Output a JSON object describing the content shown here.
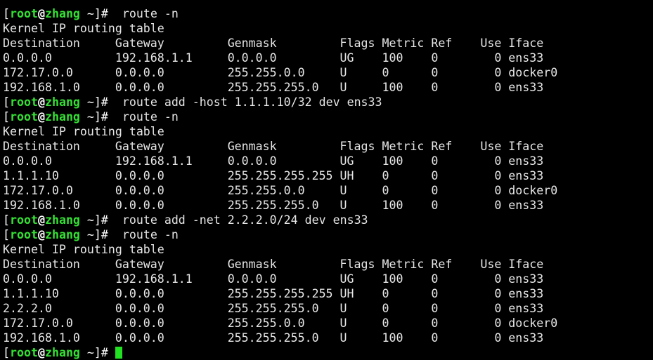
{
  "prompt": {
    "open": "[",
    "user": "root",
    "at": "@",
    "host": "zhang",
    "cwd": " ~",
    "close": "]",
    "symbol": "#"
  },
  "theme": {
    "background": "#000000",
    "text": "#e6e6e6",
    "prompt_user_color": "#35e035",
    "cursor_color": "#22e022"
  },
  "session": [
    {
      "type": "command",
      "text": "  route -n"
    },
    {
      "type": "output",
      "text": "Kernel IP routing table"
    },
    {
      "type": "output",
      "text": "Destination     Gateway         Genmask         Flags Metric Ref    Use Iface"
    },
    {
      "type": "output",
      "text": "0.0.0.0         192.168.1.1     0.0.0.0         UG    100    0        0 ens33"
    },
    {
      "type": "output",
      "text": "172.17.0.0      0.0.0.0         255.255.0.0     U     0      0        0 docker0"
    },
    {
      "type": "output",
      "text": "192.168.1.0     0.0.0.0         255.255.255.0   U     100    0        0 ens33"
    },
    {
      "type": "command",
      "text": "  route add -host 1.1.1.10/32 dev ens33"
    },
    {
      "type": "command",
      "text": "  route -n"
    },
    {
      "type": "output",
      "text": "Kernel IP routing table"
    },
    {
      "type": "output",
      "text": "Destination     Gateway         Genmask         Flags Metric Ref    Use Iface"
    },
    {
      "type": "output",
      "text": "0.0.0.0         192.168.1.1     0.0.0.0         UG    100    0        0 ens33"
    },
    {
      "type": "output",
      "text": "1.1.1.10        0.0.0.0         255.255.255.255 UH    0      0        0 ens33"
    },
    {
      "type": "output",
      "text": "172.17.0.0      0.0.0.0         255.255.0.0     U     0      0        0 docker0"
    },
    {
      "type": "output",
      "text": "192.168.1.0     0.0.0.0         255.255.255.0   U     100    0        0 ens33"
    },
    {
      "type": "command",
      "text": "  route add -net 2.2.2.0/24 dev ens33"
    },
    {
      "type": "command",
      "text": "  route -n"
    },
    {
      "type": "output",
      "text": "Kernel IP routing table"
    },
    {
      "type": "output",
      "text": "Destination     Gateway         Genmask         Flags Metric Ref    Use Iface"
    },
    {
      "type": "output",
      "text": "0.0.0.0         192.168.1.1     0.0.0.0         UG    100    0        0 ens33"
    },
    {
      "type": "output",
      "text": "1.1.1.10        0.0.0.0         255.255.255.255 UH    0      0        0 ens33"
    },
    {
      "type": "output",
      "text": "2.2.2.0         0.0.0.0         255.255.255.0   U     0      0        0 ens33"
    },
    {
      "type": "output",
      "text": "172.17.0.0      0.0.0.0         255.255.0.0     U     0      0        0 docker0"
    },
    {
      "type": "output",
      "text": "192.168.1.0     0.0.0.0         255.255.255.0   U     100    0        0 ens33"
    },
    {
      "type": "active",
      "text": " "
    }
  ]
}
